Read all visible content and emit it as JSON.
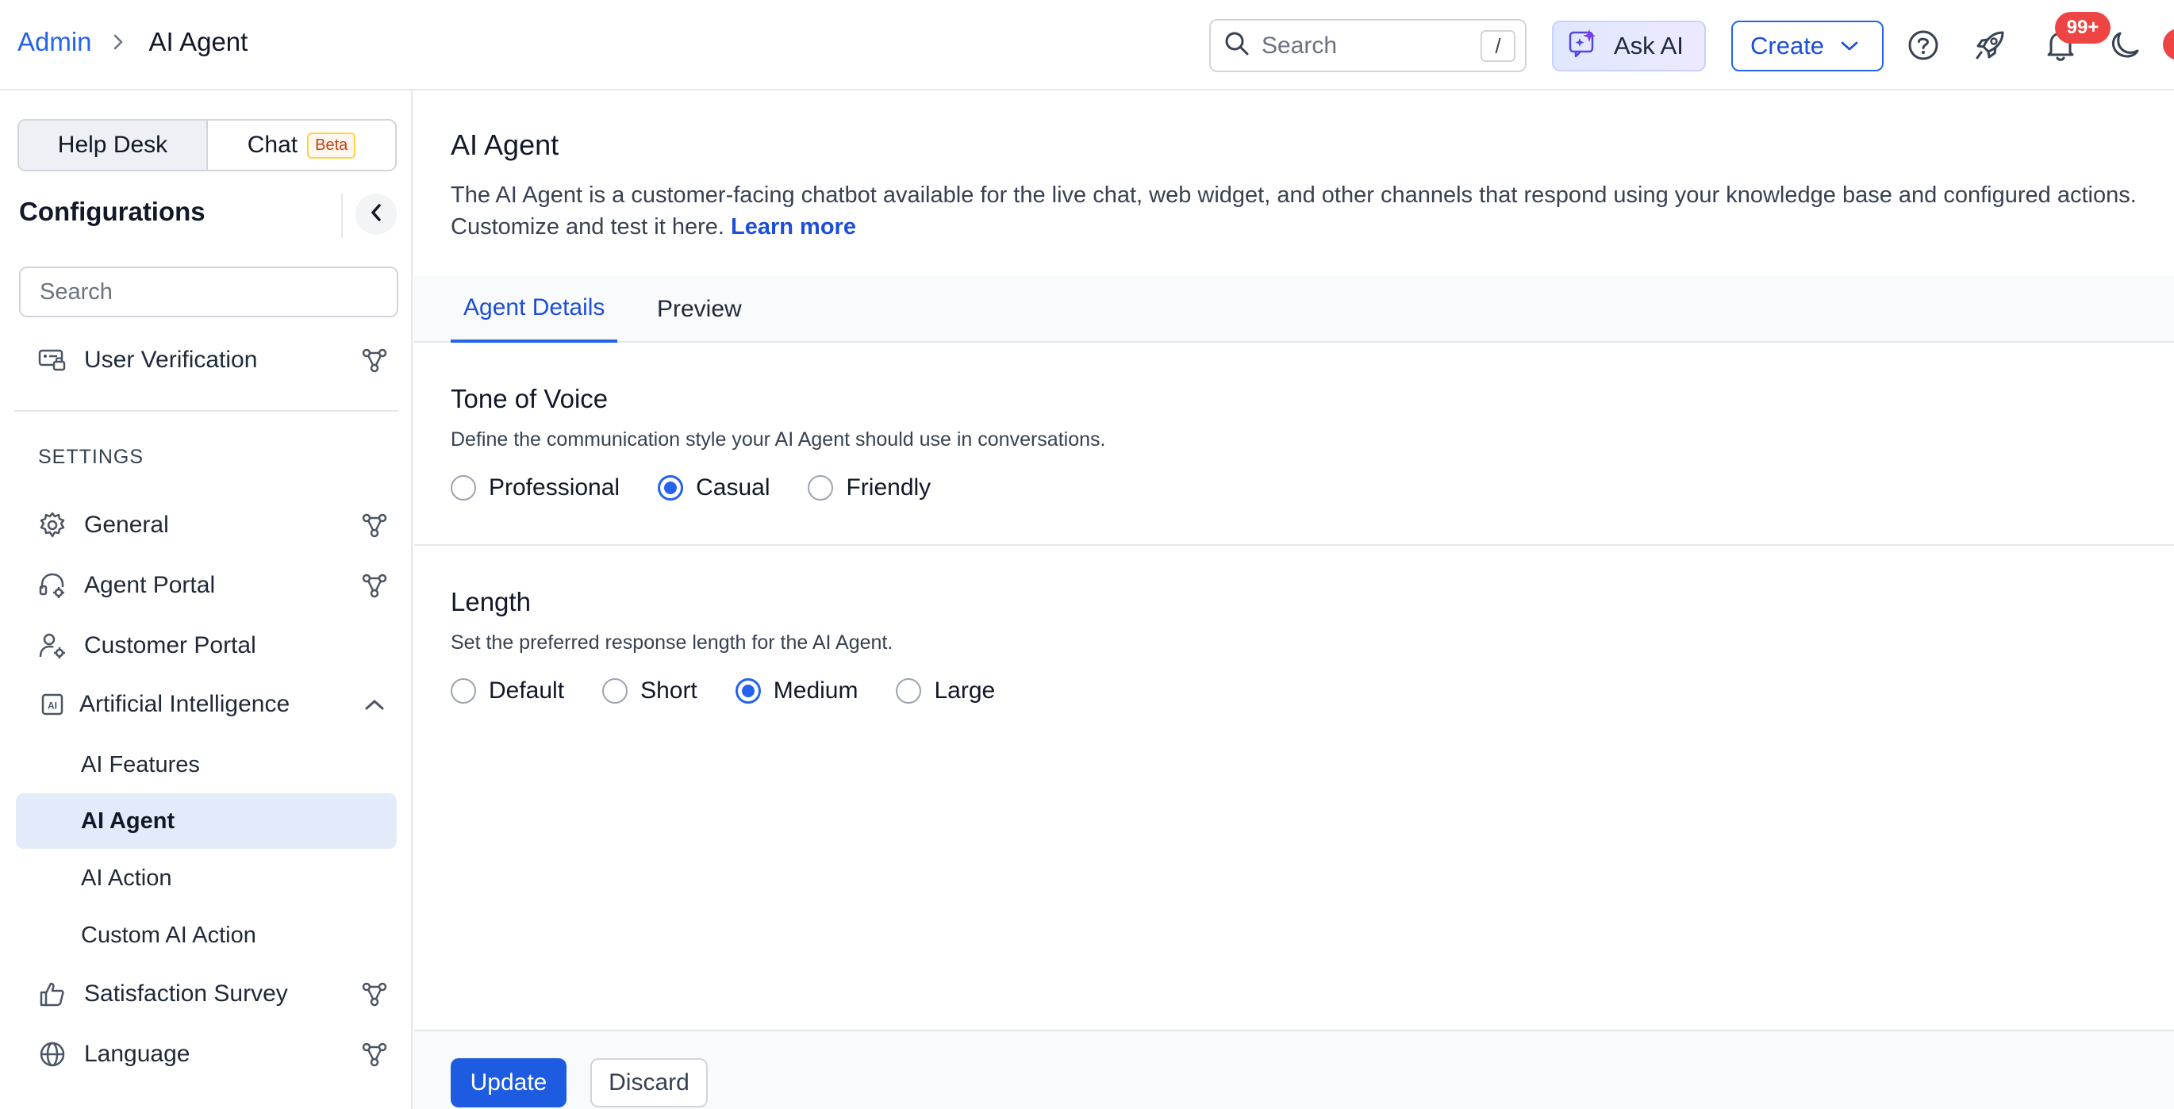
{
  "header": {
    "breadcrumb": {
      "parent": "Admin",
      "current": "AI Agent"
    },
    "search": {
      "placeholder": "Search",
      "shortcut": "/"
    },
    "ask_ai_label": "Ask AI",
    "create_label": "Create",
    "notifications_badge": "99+"
  },
  "sidebar": {
    "segments": [
      {
        "label": "Help Desk",
        "active": true
      },
      {
        "label": "Chat",
        "badge": "Beta",
        "active": false
      }
    ],
    "title": "Configurations",
    "search_placeholder": "Search",
    "top_items": [
      {
        "label": "User Verification",
        "icon": "user-verification-icon"
      }
    ],
    "section_label": "SETTINGS",
    "settings_items": [
      {
        "label": "General",
        "icon": "gear-icon"
      },
      {
        "label": "Agent Portal",
        "icon": "headset-gear-icon"
      },
      {
        "label": "Customer Portal",
        "icon": "user-gear-icon"
      },
      {
        "label": "Artificial Intelligence",
        "icon": "ai-icon",
        "expanded": true
      }
    ],
    "ai_subitems": [
      {
        "label": "AI Features",
        "active": false
      },
      {
        "label": "AI Agent",
        "active": true
      },
      {
        "label": "AI Action",
        "active": false
      },
      {
        "label": "Custom AI Action",
        "active": false
      }
    ],
    "bottom_items": [
      {
        "label": "Satisfaction Survey",
        "icon": "thumbs-up-icon"
      },
      {
        "label": "Language",
        "icon": "globe-icon"
      }
    ]
  },
  "main": {
    "title": "AI Agent",
    "description": "The AI Agent is a customer-facing chatbot available for the live chat, web widget, and other channels that respond using your knowledge base and configured actions. Customize and test it here.",
    "learn_more": "Learn more",
    "tabs": [
      {
        "label": "Agent Details",
        "active": true
      },
      {
        "label": "Preview",
        "active": false
      }
    ],
    "tone": {
      "heading": "Tone of Voice",
      "subtitle": "Define the communication style your AI Agent should use in conversations.",
      "options": [
        "Professional",
        "Casual",
        "Friendly"
      ],
      "selected": "Casual"
    },
    "length": {
      "heading": "Length",
      "subtitle": "Set the preferred response length for the AI Agent.",
      "options": [
        "Default",
        "Short",
        "Medium",
        "Large"
      ],
      "selected": "Medium"
    },
    "footer": {
      "update_label": "Update",
      "discard_label": "Discard"
    }
  },
  "colors": {
    "accent": "#2563eb",
    "active_nav_bg": "#e3ebfb",
    "badge": "#ef4444"
  }
}
